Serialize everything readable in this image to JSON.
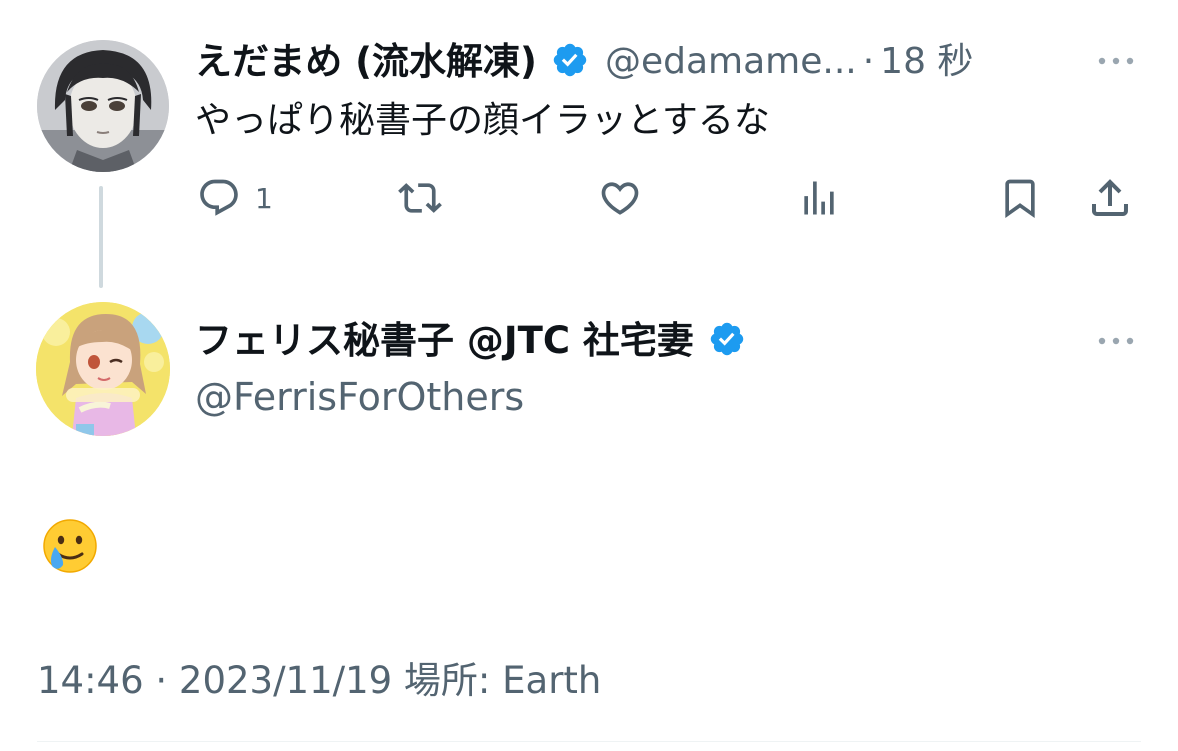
{
  "parent_tweet": {
    "display_name": "えだまめ (流水解凍)",
    "handle": "@edamame...",
    "separator": "·",
    "time_ago": "18 秒",
    "text": "やっぱり秘書子の顔イラッとするな",
    "reply_count": "1",
    "verified_color": "#1d9bf0"
  },
  "reply_tweet": {
    "display_name": "フェリス秘書子 @JTC 社宅妻",
    "handle": "@FerrisForOthers",
    "emoji": "crying-smile-emoji",
    "timestamp": "14:46 · 2023/11/19 場所: Earth"
  },
  "icons": {
    "reply": "reply-icon",
    "retweet": "retweet-icon",
    "like": "heart-icon",
    "views": "views-icon",
    "bookmark": "bookmark-icon",
    "share": "share-icon",
    "more": "more-icon",
    "verified": "verified-badge-icon"
  }
}
